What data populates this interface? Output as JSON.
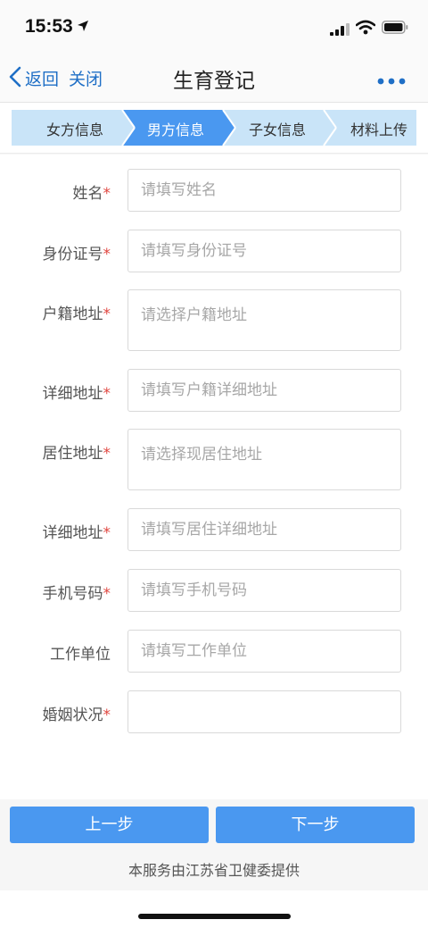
{
  "status_bar": {
    "time": "15:53",
    "icons": [
      "location-arrow-icon",
      "cellular-signal-icon",
      "wifi-icon",
      "battery-icon"
    ]
  },
  "nav": {
    "back_label": "返回",
    "close_label": "关闭",
    "title": "生育登记",
    "more_icon": "more-dots-icon",
    "accent_color": "#1f6fc6"
  },
  "steps": {
    "items": [
      {
        "label": "女方信息",
        "active": false
      },
      {
        "label": "男方信息",
        "active": true
      },
      {
        "label": "子女信息",
        "active": false
      },
      {
        "label": "材料上传",
        "active": false
      }
    ],
    "active_color": "#4a98f0",
    "inactive_color": "#c9e4f8"
  },
  "form": {
    "required_mark": "*",
    "fields": [
      {
        "label": "姓名",
        "required": true,
        "placeholder": "请填写姓名",
        "value": ""
      },
      {
        "label": "身份证号",
        "required": true,
        "placeholder": "请填写身份证号",
        "value": ""
      },
      {
        "label": "户籍地址",
        "required": true,
        "placeholder": "请选择户籍地址",
        "value": ""
      },
      {
        "label": "详细地址",
        "required": true,
        "placeholder": "请填写户籍详细地址",
        "value": ""
      },
      {
        "label": "居住地址",
        "required": true,
        "placeholder": "请选择现居住地址",
        "value": ""
      },
      {
        "label": "详细地址",
        "required": true,
        "placeholder": "请填写居住详细地址",
        "value": ""
      },
      {
        "label": "手机号码",
        "required": true,
        "placeholder": "请填写手机号码",
        "value": ""
      },
      {
        "label": "工作单位",
        "required": false,
        "placeholder": "请填写工作单位",
        "value": ""
      },
      {
        "label": "婚姻状况",
        "required": true,
        "placeholder": "",
        "value": ""
      }
    ]
  },
  "buttons": {
    "prev_label": "上一步",
    "next_label": "下一步",
    "color": "#4a98f0"
  },
  "footer": {
    "text": "本服务由江苏省卫健委提供"
  }
}
